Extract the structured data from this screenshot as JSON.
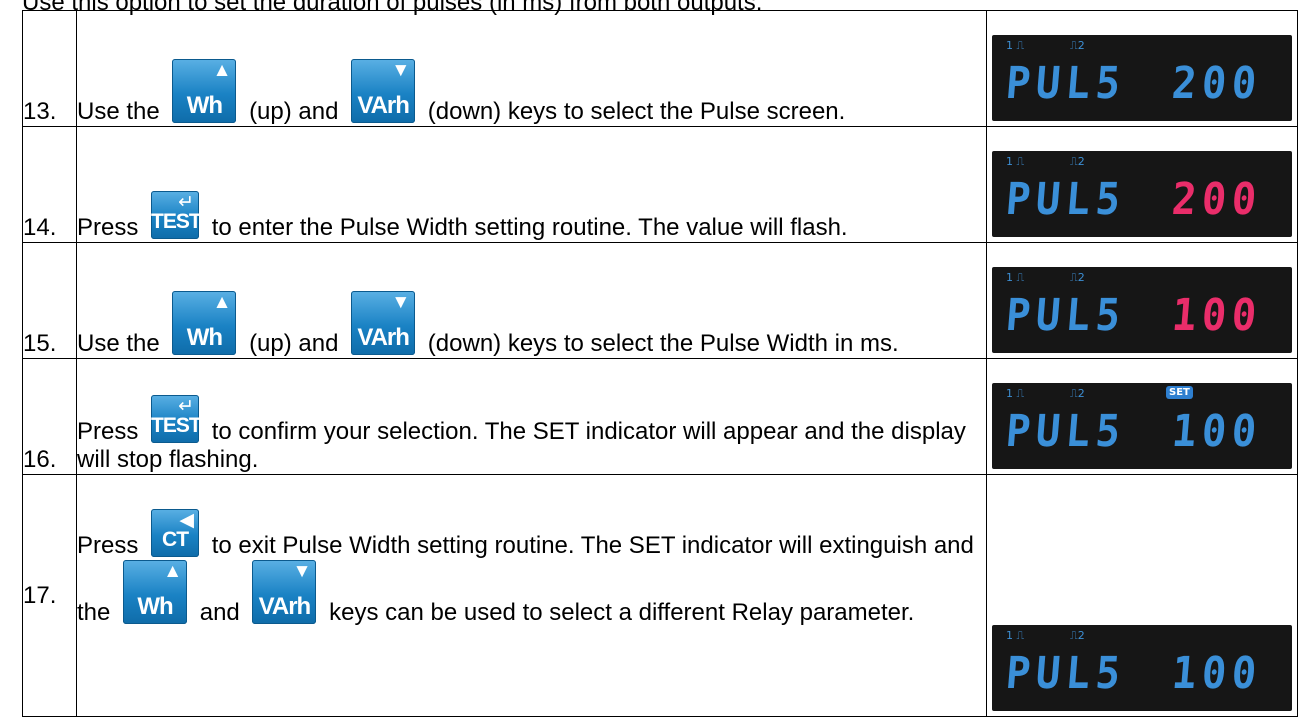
{
  "intro": "Use this option to set the duration of pulses (in ms) from both outputs.",
  "keys": {
    "up": {
      "label": "Wh",
      "glyph": "▲"
    },
    "down": {
      "label": "VArh",
      "glyph": "▼"
    },
    "enter": {
      "label": "TEST",
      "glyph": "↵"
    },
    "back": {
      "label": "CT",
      "glyph": "◀"
    }
  },
  "display": {
    "indicator1": "1 ⎍",
    "indicator2": "⎍2",
    "set_badge": "SET",
    "lhs_text": "PUL5"
  },
  "colors": {
    "lcd_blue": "#3a8fd8",
    "lcd_red": "#ea2d6a",
    "lcd_bg": "#161616",
    "key_blue": "#1a82c4"
  },
  "steps": [
    {
      "num": "13.",
      "parts": [
        "Use the",
        "(up) and",
        "(down) keys to select the Pulse screen."
      ],
      "display_value": "200",
      "value_color": "#3a8fd8"
    },
    {
      "num": "14.",
      "parts": [
        "Press",
        "to enter the Pulse Width setting routine.  The value will flash."
      ],
      "display_value": "200",
      "value_color": "#ea2d6a"
    },
    {
      "num": "15.",
      "parts": [
        "Use the",
        "(up) and",
        "(down) keys to select the Pulse Width in ms."
      ],
      "display_value": "100",
      "value_color": "#ea2d6a"
    },
    {
      "num": "16.",
      "parts": [
        "Press",
        "to confirm your selection.  The SET indicator will appear and the display will stop flashing."
      ],
      "display_value": "100",
      "value_color": "#3a8fd8"
    },
    {
      "num": "17.",
      "parts": [
        "Press",
        "to exit Pulse Width setting routine.  The SET indicator will extinguish and the",
        "and",
        "keys can be used to select a different Relay parameter."
      ],
      "display_value": "100",
      "value_color": "#3a8fd8"
    }
  ]
}
